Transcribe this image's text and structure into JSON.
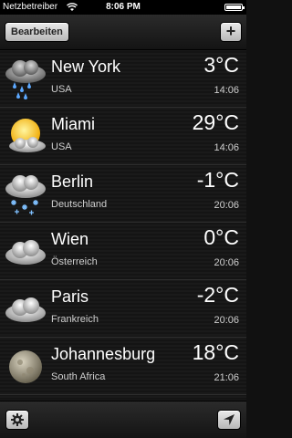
{
  "status_bar": {
    "carrier": "Netzbetreiber",
    "time": "8:06 PM"
  },
  "navbar": {
    "edit_label": "Bearbeiten",
    "add_label": "+"
  },
  "cities": [
    {
      "city": "New York",
      "country": "USA",
      "temp": "3°C",
      "time": "14:06",
      "icon": "cloud-rain-icon"
    },
    {
      "city": "Miami",
      "country": "USA",
      "temp": "29°C",
      "time": "14:06",
      "icon": "sun-cloud-icon"
    },
    {
      "city": "Berlin",
      "country": "Deutschland",
      "temp": "-1°C",
      "time": "20:06",
      "icon": "cloud-snow-icon"
    },
    {
      "city": "Wien",
      "country": "Österreich",
      "temp": "0°C",
      "time": "20:06",
      "icon": "cloud-icon"
    },
    {
      "city": "Paris",
      "country": "Frankreich",
      "temp": "-2°C",
      "time": "20:06",
      "icon": "cloud-icon"
    },
    {
      "city": "Johannesburg",
      "country": "South Africa",
      "temp": "18°C",
      "time": "21:06",
      "icon": "moon-icon"
    }
  ],
  "toolbar": {
    "settings_icon": "gear-icon",
    "location_icon": "location-arrow-icon"
  }
}
